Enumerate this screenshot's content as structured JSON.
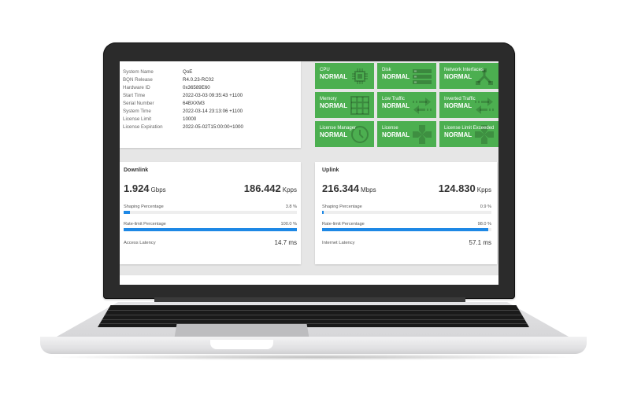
{
  "system_info": {
    "rows": [
      {
        "label": "System Name",
        "value": "QoE"
      },
      {
        "label": "BQN Release",
        "value": "R4.0.23-RC02"
      },
      {
        "label": "Hardware ID",
        "value": "0x36589E60"
      },
      {
        "label": "Start Time",
        "value": "2022-03-03 09:35:43 +1100"
      },
      {
        "label": "Serial Number",
        "value": "64BXXM3"
      },
      {
        "label": "System Time",
        "value": "2022-03-14 23:13:06 +1100"
      },
      {
        "label": "License Limit",
        "value": "10000"
      },
      {
        "label": "License Expiration",
        "value": "2022-05-02T15:00:00+1000"
      }
    ]
  },
  "status_tiles": [
    {
      "label": "CPU",
      "status": "NORMAL",
      "icon": "chip-icon"
    },
    {
      "label": "Disk",
      "status": "NORMAL",
      "icon": "disk-list-icon"
    },
    {
      "label": "Network Interfaces",
      "status": "NORMAL",
      "icon": "network-icon"
    },
    {
      "label": "Memory",
      "status": "NORMAL",
      "icon": "grid-icon"
    },
    {
      "label": "Low Traffic",
      "status": "NORMAL",
      "icon": "traffic-arrows-icon"
    },
    {
      "label": "Inverted Traffic",
      "status": "NORMAL",
      "icon": "traffic-arrows-icon"
    },
    {
      "label": "License Manager",
      "status": "NORMAL",
      "icon": "clock-icon"
    },
    {
      "label": "License",
      "status": "NORMAL",
      "icon": "license-puzzle-icon"
    },
    {
      "label": "License Limit Exceeded",
      "status": "NORMAL",
      "icon": "license-puzzle-icon"
    }
  ],
  "tile_color": "#4caf50",
  "bar_color": "#1e88e5",
  "downlink": {
    "title": "Downlink",
    "throughput": "1.924",
    "throughput_unit": "Gbps",
    "packets": "186.442",
    "packets_unit": "Kpps",
    "shaping_label": "Shaping Percentage",
    "shaping_value": "3.8 %",
    "shaping_pct": 3.8,
    "ratelimit_label": "Rate-limit Percentage",
    "ratelimit_value": "100.0 %",
    "ratelimit_pct": 100.0,
    "latency_label": "Access Latency",
    "latency_value": "14.7 ms"
  },
  "uplink": {
    "title": "Uplink",
    "throughput": "216.344",
    "throughput_unit": "Mbps",
    "packets": "124.830",
    "packets_unit": "Kpps",
    "shaping_label": "Shaping Percentage",
    "shaping_value": "0.9 %",
    "shaping_pct": 0.9,
    "ratelimit_label": "Rate-limit Percentage",
    "ratelimit_value": "98.0 %",
    "ratelimit_pct": 98.0,
    "latency_label": "Internet Latency",
    "latency_value": "57.1 ms"
  }
}
